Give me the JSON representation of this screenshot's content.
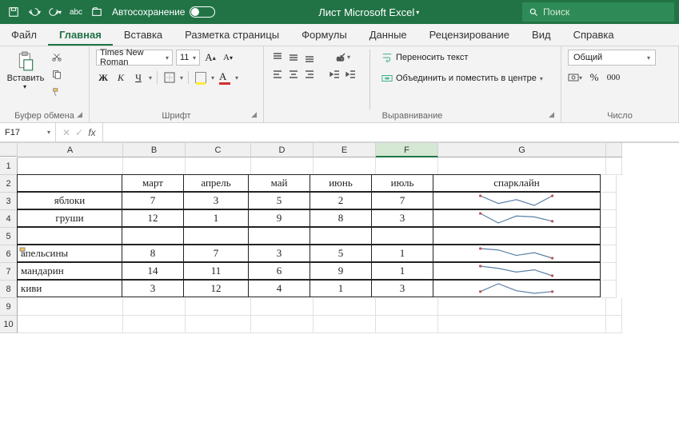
{
  "titlebar": {
    "autosave_label": "Автосохранение",
    "document_title": "Лист Microsoft Excel",
    "search_placeholder": "Поиск"
  },
  "tabs": {
    "file": "Файл",
    "home": "Главная",
    "insert": "Вставка",
    "pagelayout": "Разметка страницы",
    "formulas": "Формулы",
    "data": "Данные",
    "review": "Рецензирование",
    "view": "Вид",
    "help": "Справка"
  },
  "ribbon": {
    "clipboard": {
      "paste": "Вставить",
      "group": "Буфер обмена"
    },
    "font": {
      "name": "Times New Roman",
      "size": "11",
      "bold": "Ж",
      "italic": "К",
      "underline": "Ч",
      "group": "Шрифт"
    },
    "alignment": {
      "wrap": "Переносить текст",
      "merge": "Объединить и поместить в центре",
      "group": "Выравнивание"
    },
    "number": {
      "format": "Общий",
      "group": "Число"
    }
  },
  "formulabar": {
    "namebox": "F17",
    "fx": "fx"
  },
  "cols": [
    "A",
    "B",
    "C",
    "D",
    "E",
    "F",
    "G"
  ],
  "table": {
    "headers": {
      "b": "март",
      "c": "апрель",
      "d": "май",
      "e": "июнь",
      "f": "июль",
      "g": "спарклайн"
    },
    "rows": [
      {
        "label": "яблоки",
        "vals": [
          7,
          3,
          5,
          2,
          7
        ]
      },
      {
        "label": "груши",
        "vals": [
          12,
          1,
          9,
          8,
          3
        ]
      },
      {
        "label": "апельсины",
        "vals": [
          8,
          7,
          3,
          5,
          1
        ],
        "tagged": true
      },
      {
        "label": "мандарин",
        "vals": [
          14,
          11,
          6,
          9,
          1
        ]
      },
      {
        "label": "киви",
        "vals": [
          3,
          12,
          4,
          1,
          3
        ]
      }
    ]
  },
  "chart_data": [
    {
      "type": "line",
      "title": "яблоки",
      "categories": [
        "март",
        "апрель",
        "май",
        "июнь",
        "июль"
      ],
      "values": [
        7,
        3,
        5,
        2,
        7
      ]
    },
    {
      "type": "line",
      "title": "груши",
      "categories": [
        "март",
        "апрель",
        "май",
        "июнь",
        "июль"
      ],
      "values": [
        12,
        1,
        9,
        8,
        3
      ]
    },
    {
      "type": "line",
      "title": "апельсины",
      "categories": [
        "март",
        "апрель",
        "май",
        "июнь",
        "июль"
      ],
      "values": [
        8,
        7,
        3,
        5,
        1
      ]
    },
    {
      "type": "line",
      "title": "мандарин",
      "categories": [
        "март",
        "апрель",
        "май",
        "июнь",
        "июль"
      ],
      "values": [
        14,
        11,
        6,
        9,
        1
      ]
    },
    {
      "type": "line",
      "title": "киви",
      "categories": [
        "март",
        "апрель",
        "май",
        "июнь",
        "июль"
      ],
      "values": [
        3,
        12,
        4,
        1,
        3
      ]
    }
  ]
}
